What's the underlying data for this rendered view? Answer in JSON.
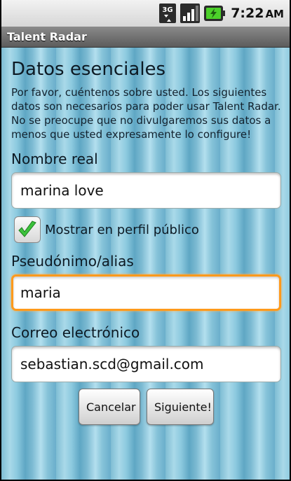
{
  "status_bar": {
    "network_label": "3G",
    "time": "7:22",
    "ampm": "AM",
    "icons": [
      "3g-data-icon",
      "signal-strength-icon",
      "battery-charging-icon"
    ]
  },
  "app": {
    "title": "Talent Radar"
  },
  "form": {
    "heading": "Datos esenciales",
    "intro": "Por favor, cuéntenos sobre usted. Los siguientes datos son necesarios para poder usar Talent Radar. No se preocupe que no divulgaremos sus datos a menos que usted expresamente lo configure!",
    "real_name": {
      "label": "Nombre real",
      "value": "marina love"
    },
    "public_profile": {
      "label": "Mostrar en perfil público",
      "checked": true
    },
    "alias": {
      "label": "Pseudónimo/alias",
      "value": "maria"
    },
    "email": {
      "label": "Correo electrónico",
      "value": "sebastian.scd@gmail.com"
    },
    "cancel_label": "Cancelar",
    "next_label": "Siguiente!"
  },
  "colors": {
    "focus": "#ff9a1c",
    "check": "#3cc23c",
    "background_stripe": "#7fbdd3"
  }
}
